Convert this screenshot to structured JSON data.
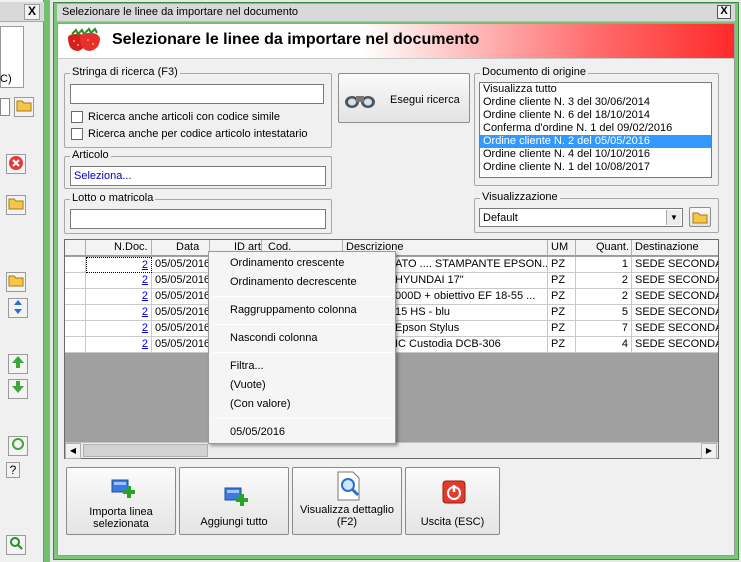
{
  "window": {
    "title": "Selezionare le linee da importare nel documento",
    "close": "X"
  },
  "banner": {
    "title": "Selezionare le linee da importare nel documento"
  },
  "search": {
    "group_label": "Stringa di ricerca (F3)",
    "value": "",
    "option_similar": "Ricerca anche articoli con codice simile",
    "option_holder": "Ricerca anche per codice articolo intestatario",
    "button": "Esegui ricerca"
  },
  "articolo": {
    "group_label": "Articolo",
    "value": "Seleziona..."
  },
  "lotto": {
    "group_label": "Lotto o matricola",
    "value": ""
  },
  "origine": {
    "group_label": "Documento di origine",
    "items": [
      "Visualizza tutto",
      "Ordine cliente N. 3 del 30/06/2014",
      "Ordine cliente N. 6 del 18/10/2014",
      "Conferma d'ordine N. 1 del 09/02/2016",
      "Ordine cliente N. 2 del 05/05/2016",
      "Ordine cliente N. 4 del 10/10/2016",
      "Ordine cliente N. 1 del 10/08/2017"
    ],
    "selected": "Ordine cliente N. 2 del 05/05/2016"
  },
  "visualizzazione": {
    "group_label": "Visualizzazione",
    "value": "Default"
  },
  "grid": {
    "headers": [
      "N.Doc.",
      "Data",
      "ID art.",
      "Cod.",
      "Descrizione",
      "UM",
      "Quant.",
      "Destinazione"
    ],
    "rows": [
      {
        "ndoc": "2",
        "data": "05/05/2016",
        "descr": "ATO .... STAMPANTE EPSON...",
        "um": "PZ",
        "qty": "1",
        "dest": "SEDE SECONDARIA"
      },
      {
        "ndoc": "2",
        "data": "05/05/2016",
        "descr": "HYUNDAI 17\"",
        "um": "PZ",
        "qty": "2",
        "dest": "SEDE SECONDARIA"
      },
      {
        "ndoc": "2",
        "data": "05/05/2016",
        "descr": "000D + obiettivo EF 18-55 ...",
        "um": "PZ",
        "qty": "2",
        "dest": "SEDE SECONDARIA"
      },
      {
        "ndoc": "2",
        "data": "05/05/2016",
        "descr": "15 HS - blu",
        "um": "PZ",
        "qty": "5",
        "dest": "SEDE SECONDARIA"
      },
      {
        "ndoc": "2",
        "data": "05/05/2016",
        "descr": "Epson Stylus",
        "um": "PZ",
        "qty": "7",
        "dest": "SEDE SECONDARIA"
      },
      {
        "ndoc": "2",
        "data": "05/05/2016",
        "descr": "IC Custodia DCB-306",
        "um": "PZ",
        "qty": "4",
        "dest": "SEDE SECONDARIA"
      }
    ]
  },
  "context_menu": {
    "items": [
      "Ordinamento crescente",
      "Ordinamento decrescente",
      "Raggruppamento colonna",
      "Nascondi colonna",
      "Filtra...",
      "(Vuote)",
      "(Con valore)",
      "05/05/2016"
    ]
  },
  "actions": {
    "import": "Importa linea selezionata",
    "add_all": "Aggiungi tutto",
    "detail": "Visualizza dettaglio (F2)",
    "exit": "Uscita (ESC)"
  },
  "background": {
    "close": "X",
    "label": "C)"
  },
  "colors": {
    "banner_red": "#ff2a2a",
    "dialog_green": "#7bc67b",
    "selection": "#3399ff",
    "link": "#0000cc"
  }
}
